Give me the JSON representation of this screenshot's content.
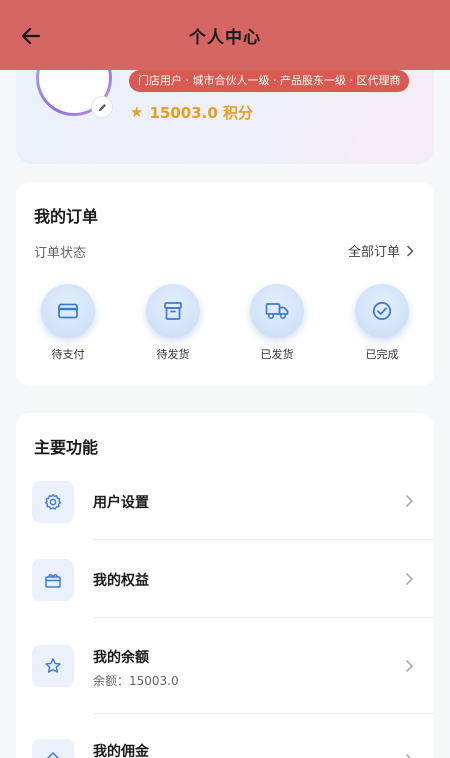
{
  "header": {
    "title": "个人中心"
  },
  "profile": {
    "roles": "门店用户 · 城市合伙人一级 · 产品股东一级 · 区代理商",
    "points": "15003.0 积分"
  },
  "orders": {
    "title": "我的订单",
    "status_label": "订单状态",
    "all_orders": "全部订单",
    "items": [
      {
        "label": "待支付",
        "icon": "card-icon"
      },
      {
        "label": "待发货",
        "icon": "box-icon"
      },
      {
        "label": "已发货",
        "icon": "truck-icon"
      },
      {
        "label": "已完成",
        "icon": "check-circle-icon"
      }
    ]
  },
  "functions": {
    "title": "主要功能",
    "items": [
      {
        "label": "用户设置",
        "icon": "gear-icon"
      },
      {
        "label": "我的权益",
        "icon": "gift-icon"
      },
      {
        "label": "我的余额",
        "sub": "余额：15003.0",
        "icon": "star-icon"
      },
      {
        "label": "我的佣金",
        "icon": "diamond-icon"
      }
    ]
  },
  "colors": {
    "header_bg": "#d56663",
    "badge_bg": "#d95a50",
    "points": "#e6a020",
    "icon_accent": "#3d7ad6"
  }
}
